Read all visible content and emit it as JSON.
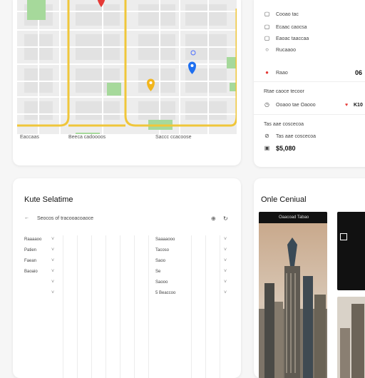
{
  "map": {
    "caption": [
      "Eaccaas",
      "Beeca cadoooos",
      "Saccc ccacoose"
    ]
  },
  "details": {
    "rows": [
      {
        "icon": "square-icon",
        "text": "Cooao tac"
      },
      {
        "icon": "square-icon",
        "text": "Ecaac caocsa"
      },
      {
        "icon": "square-icon",
        "text": "Eaoac taaccaa"
      },
      {
        "icon": "circle-icon",
        "text": "Rucaaoo"
      },
      {
        "icon": "pin-icon",
        "text": "Raao",
        "value": "06"
      }
    ],
    "section_label": "Rtae caoce tecoor",
    "time_row": {
      "text": "Ooaoo tae Oaooo",
      "tag": "K10"
    },
    "price_label": "Tas aae coscecoa",
    "price_value": "$5,080"
  },
  "route": {
    "title": "Kute Selatime",
    "search_text": "Seocos of tracooacoaoce",
    "left_items": [
      "Raaaaoo",
      "Patien",
      "Faean",
      "Baoaio",
      "",
      ""
    ],
    "right_items": [
      "Saaaaooo",
      "Tacoso",
      "Saoo",
      "Se",
      "Saooo",
      "5 Beaccoo"
    ]
  },
  "city": {
    "title": "Onle Ceniual",
    "photo_label": "Oaacoad Tabao"
  },
  "colors": {
    "road": "#f0c63a",
    "park": "#a6d99b",
    "pin_red": "#e53935",
    "pin_blue": "#1e6ff0",
    "pin_yellow": "#f2b51c"
  }
}
